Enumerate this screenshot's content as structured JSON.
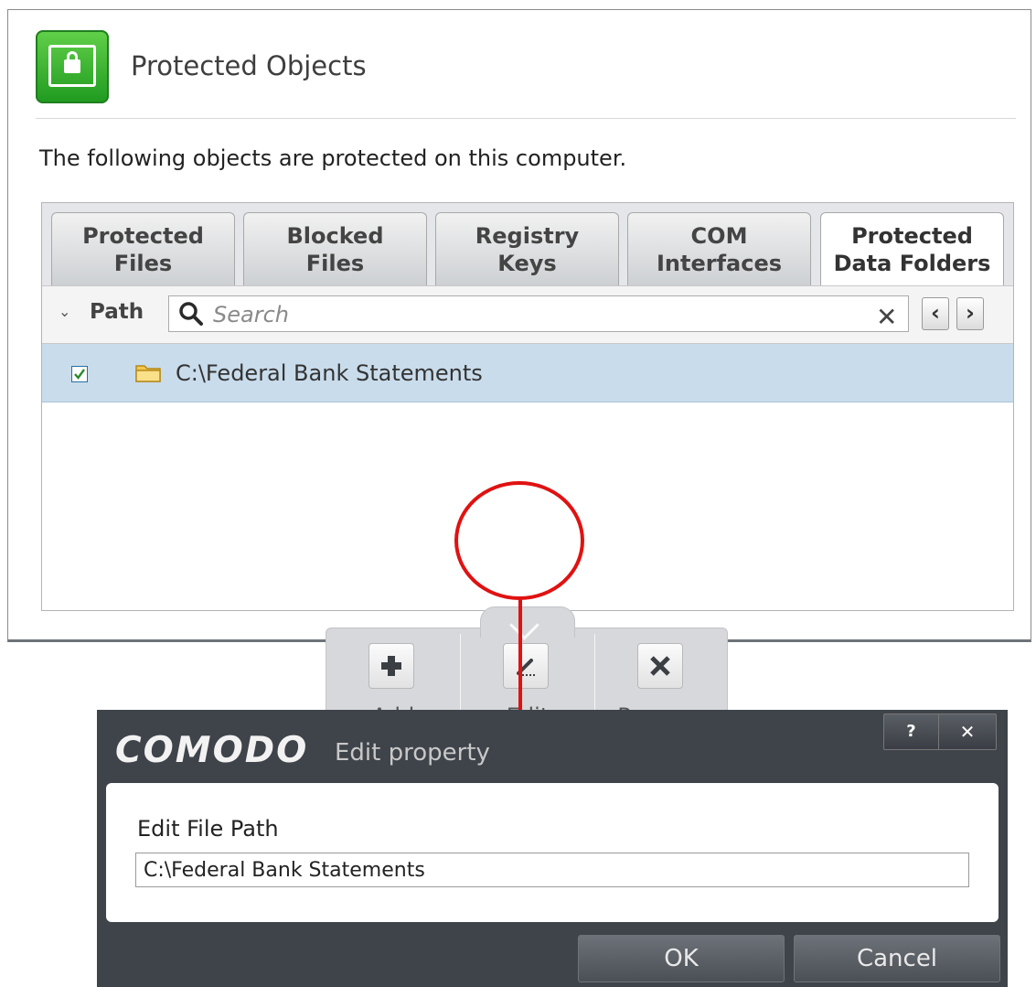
{
  "main_window": {
    "title": "Protected Objects",
    "description": "The following objects are protected on this computer.",
    "tabs": [
      {
        "line1": "Protected",
        "line2": "Files"
      },
      {
        "line1": "Blocked",
        "line2": "Files"
      },
      {
        "line1": "Registry",
        "line2": "Keys"
      },
      {
        "line1": "COM",
        "line2": "Interfaces"
      },
      {
        "line1": "Protected",
        "line2": "Data Folders"
      }
    ],
    "active_tab_index": 4,
    "column_header": "Path",
    "search": {
      "placeholder": "Search",
      "value": ""
    },
    "rows": [
      {
        "path": "C:\\Federal Bank Statements",
        "checked": true,
        "icon": "folder-icon"
      }
    ],
    "actions": {
      "add_label": "Add",
      "edit_label": "Edit",
      "remove_label": "Remove"
    }
  },
  "annotation": {
    "color": "#e01212"
  },
  "dialog": {
    "logo": "COMODO",
    "title": "Edit property",
    "help_label": "?",
    "close_label": "✕",
    "field_label": "Edit File Path",
    "field_value": "C:\\Federal Bank Statements",
    "ok_label": "OK",
    "cancel_label": "Cancel"
  },
  "colors": {
    "accent_green": "#3bb83b",
    "selected_row": "#c9dceb",
    "dialog_bg": "#3f434a"
  }
}
